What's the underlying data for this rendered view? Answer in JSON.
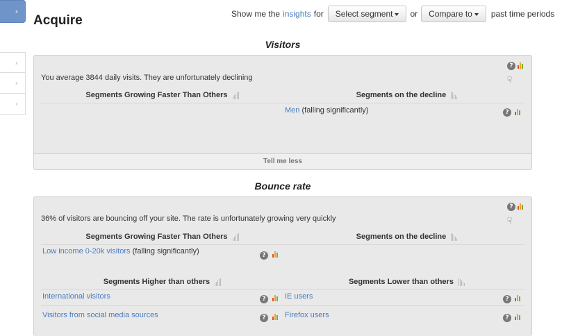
{
  "page": {
    "title": "Acquire"
  },
  "sidebar": {
    "chevron": "›"
  },
  "controls": {
    "prefix": "Show me the",
    "link": "insights",
    "for": "for",
    "segment_button": "Select segment",
    "or": "or",
    "compare_button": "Compare to",
    "suffix": "past time periods"
  },
  "visitors": {
    "title": "Visitors",
    "summary": "You average 3844 daily visits. They are unfortunately declining",
    "growing_header": "Segments Growing Faster Than Others",
    "decline_header": "Segments on the decline",
    "decline_item": {
      "link": "Men",
      "note": "(falling significantly)"
    },
    "footer": "Tell me less"
  },
  "bounce": {
    "title": "Bounce rate",
    "summary": "36% of visitors are bouncing off your site. The rate is unfortunately growing very quickly",
    "growing_header": "Segments Growing Faster Than Others",
    "decline_header": "Segments on the decline",
    "growing_item": {
      "link": "Low income 0-20k visitors",
      "note": "(falling significantly)"
    },
    "higher_header": "Segments Higher than others",
    "lower_header": "Segments Lower than others",
    "higher_items": [
      "International visitors",
      "Visitors from social media sources"
    ],
    "lower_items": [
      "IE users",
      "Firefox users"
    ]
  },
  "icons": {
    "help": "?",
    "hand": "☟"
  }
}
